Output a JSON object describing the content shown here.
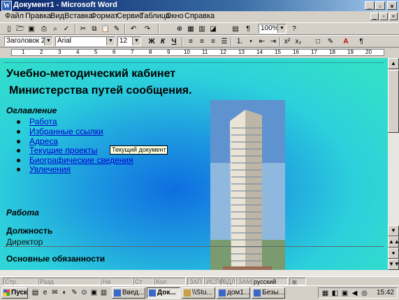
{
  "window": {
    "title": "Документ1 - Microsoft Word",
    "app_icon": "W"
  },
  "menu": [
    "Файл",
    "Правка",
    "Вид",
    "Вставка",
    "Формат",
    "Сервис",
    "Таблица",
    "Окно",
    "Справка"
  ],
  "formatting": {
    "style": "Заголовок 2",
    "font": "Arial",
    "size": "12"
  },
  "zoom": "100%",
  "ruler_numbers": [
    "1",
    "2",
    "3",
    "4",
    "5",
    "6",
    "7",
    "8",
    "9",
    "10",
    "11",
    "12",
    "13",
    "14",
    "15",
    "16",
    "17",
    "18",
    "19",
    "20"
  ],
  "document": {
    "heading_line1": "Учебно-методический кабинет",
    "heading_line2": "Министерства путей сообщения.",
    "toc_title": "Оглавление",
    "toc": [
      "Работа",
      "Избранные ссылки",
      "Адреса",
      "Текущие проекты",
      "Биографические сведения",
      "Увлечения"
    ],
    "tooltip": "Текущий документ",
    "section_title": "Работа",
    "position_label": "Должность",
    "position_value": "Директор",
    "duties_label": "Основные обязанности"
  },
  "status": {
    "page": "Стр.",
    "section": "Разд",
    "at": "На",
    "line": "Ст",
    "col": "Кол",
    "rec": "ЗАП",
    "trk": "ИСПР",
    "ext": "ВДЛ",
    "ovr": "ЗАМ",
    "language": "русский (Ро"
  },
  "taskbar": {
    "start": "Пуск",
    "tasks": [
      "Введ...",
      "Док...",
      "\\\\Stu...",
      "дом1...",
      "Безы..."
    ],
    "clock": "15:42"
  },
  "icons": [
    "app-word-icon",
    "new-doc-icon",
    "open-icon",
    "save-icon",
    "print-icon",
    "preview-icon",
    "spelling-icon",
    "cut-icon",
    "copy-icon",
    "paste-icon",
    "format-painter-icon",
    "undo-icon",
    "redo-icon",
    "hyperlink-icon",
    "table-icon",
    "columns-icon",
    "drawing-icon",
    "docmap-icon",
    "help-icon",
    "bold-icon",
    "italic-icon",
    "underline-icon",
    "align-left-icon",
    "align-center-icon",
    "align-right-icon",
    "justify-icon",
    "numbering-icon",
    "bullets-icon",
    "outdent-icon",
    "indent-icon",
    "superscript-icon",
    "subscript-icon",
    "border-icon",
    "highlight-icon",
    "font-color-icon",
    "pilcrow-icon",
    "start-flag-icon"
  ],
  "colors": {
    "title_bar": "#0a246a",
    "link": "#0000cc",
    "doc_bg_center": "#0e6fe0",
    "doc_bg_edge": "#33dfc8"
  }
}
